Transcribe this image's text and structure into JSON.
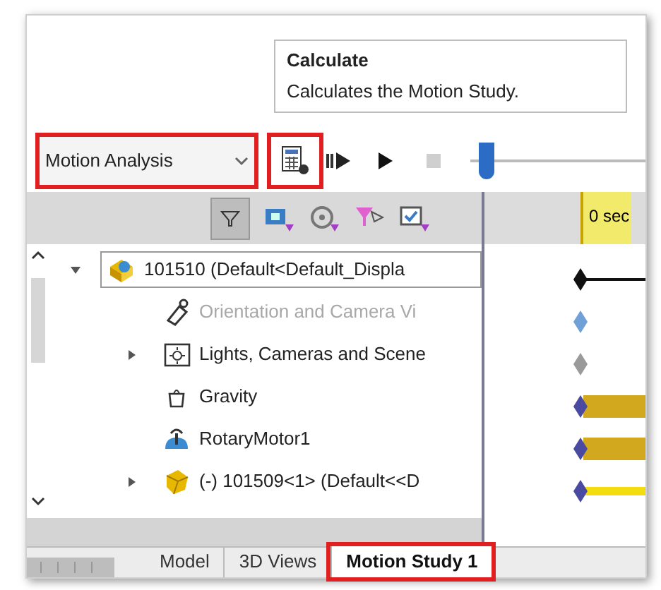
{
  "tooltip": {
    "title": "Calculate",
    "description": "Calculates the Motion Study."
  },
  "toolbar": {
    "study_type": {
      "value": "Motion Analysis",
      "highlighted": true
    },
    "calculate": {
      "highlighted": true
    },
    "timeline_slider": {
      "level": 0.05
    }
  },
  "filter_bar": {
    "filter_selected": true
  },
  "timeline": {
    "header": "0 sec",
    "tracks": [
      {
        "kind": "line",
        "color": "#111111"
      },
      {
        "kind": "none",
        "color": "#6fa0d8"
      },
      {
        "kind": "none",
        "color": "#9a9a9a"
      },
      {
        "kind": "thick",
        "color": "#4a4aa0"
      },
      {
        "kind": "thick",
        "color": "#4a4aa0"
      },
      {
        "kind": "thin",
        "color": "#4a4aa0"
      }
    ]
  },
  "tree": [
    {
      "label": "101510  (Default<Default_Displa",
      "kind": "assembly",
      "expanded": true,
      "disabled": false,
      "children": [
        {
          "label": "Orientation and Camera Vi",
          "kind": "camera",
          "disabled": true
        },
        {
          "label": "Lights, Cameras and Scene",
          "kind": "folder",
          "expanded": false,
          "disabled": false
        },
        {
          "label": "Gravity",
          "kind": "gravity",
          "disabled": false
        },
        {
          "label": "RotaryMotor1",
          "kind": "motor",
          "disabled": false
        },
        {
          "label": "(-) 101509<1> (Default<<D",
          "kind": "part",
          "expanded": false,
          "disabled": false
        }
      ]
    }
  ],
  "tabs": [
    {
      "label": "Model",
      "selected": false,
      "highlighted": false
    },
    {
      "label": "3D Views",
      "selected": false,
      "highlighted": false
    },
    {
      "label": "Motion Study 1",
      "selected": true,
      "highlighted": true
    }
  ]
}
